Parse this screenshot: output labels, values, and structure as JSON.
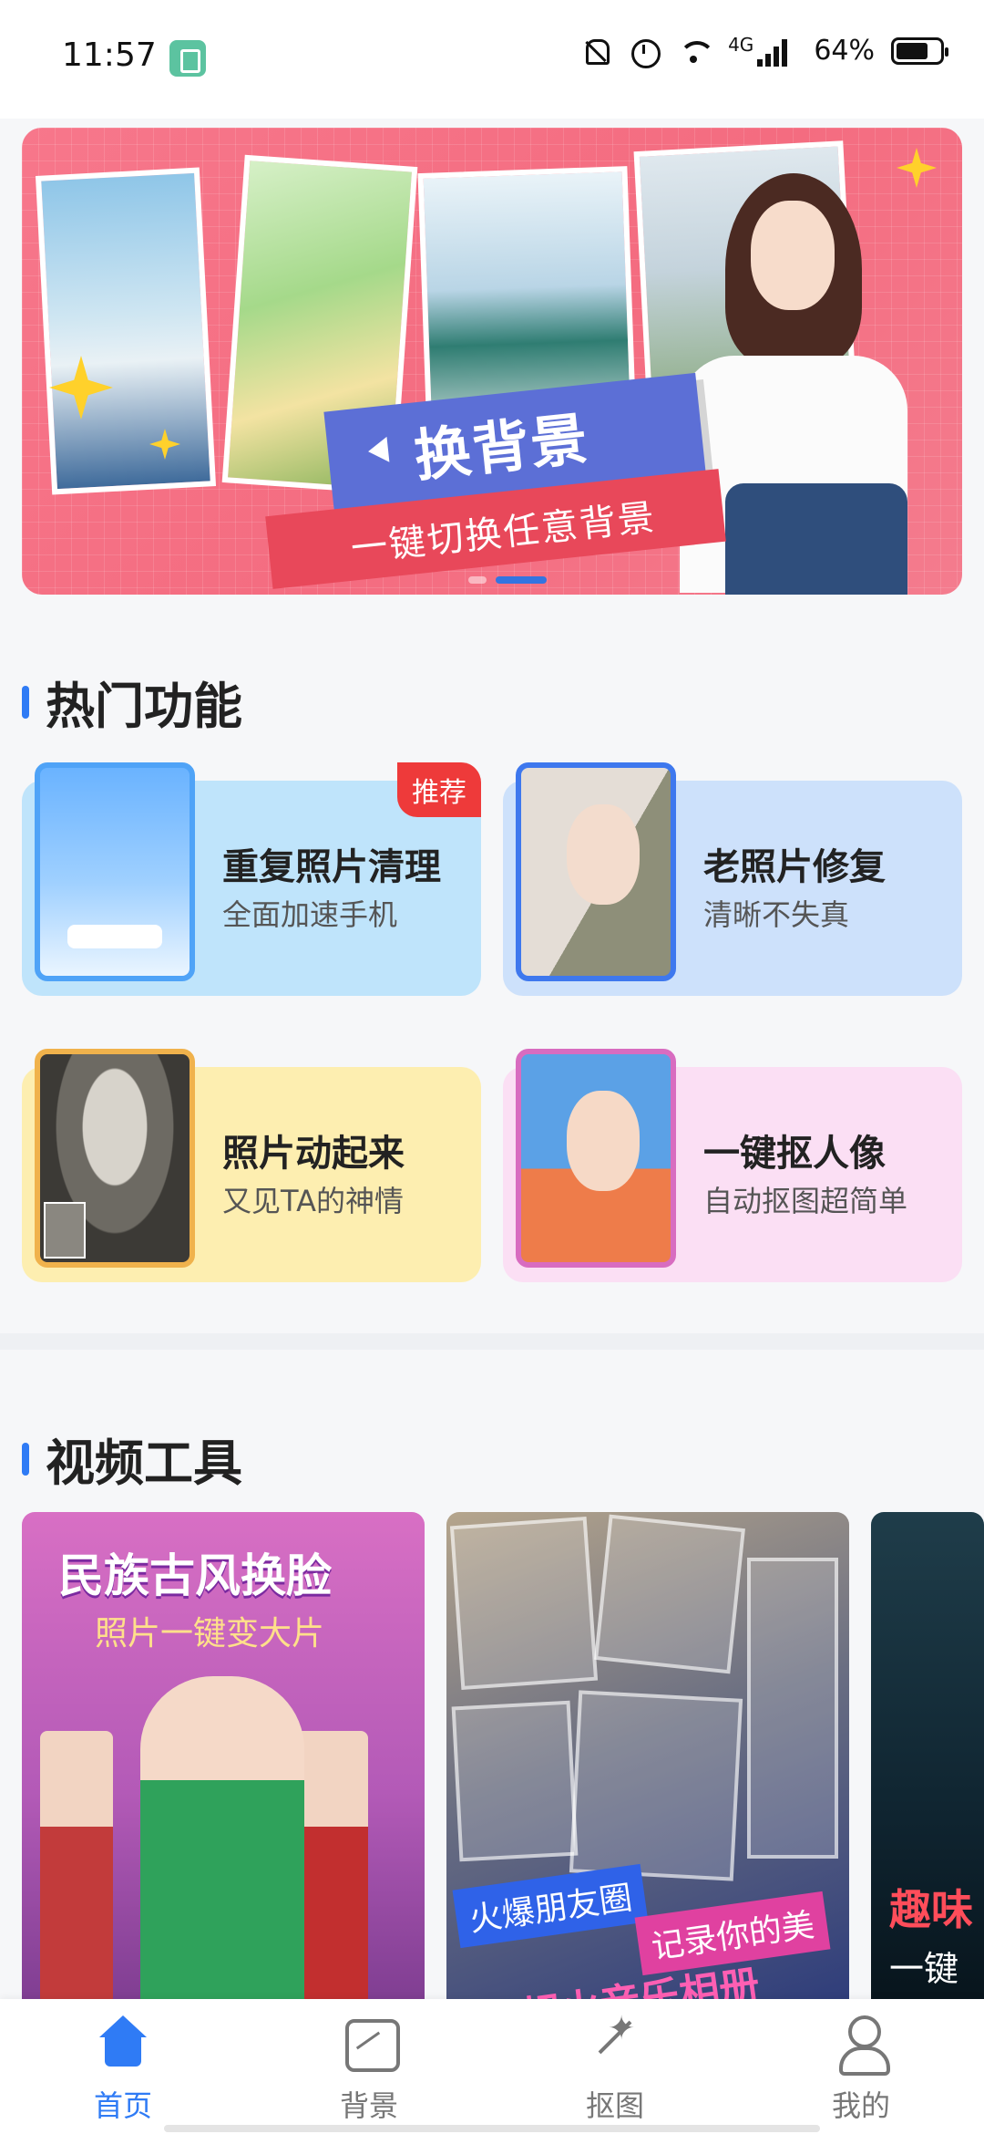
{
  "status_bar": {
    "time": "11:57",
    "network": "4G",
    "battery": "64%"
  },
  "banner": {
    "title": "换背景",
    "subtitle": "一键切换任意背景",
    "page_count": 2,
    "active_page": 2
  },
  "hot_section": {
    "title": "热门功能",
    "cards": [
      {
        "title": "重复照片清理",
        "subtitle": "全面加速手机",
        "tag": "推荐"
      },
      {
        "title": "老照片修复",
        "subtitle": "清晰不失真"
      },
      {
        "title": "照片动起来",
        "subtitle": "又见TA的神情"
      },
      {
        "title": "一键抠人像",
        "subtitle": "自动抠图超简单"
      }
    ]
  },
  "video_section": {
    "title": "视频工具",
    "cards": [
      {
        "title": "民族古风换脸",
        "subtitle": "照片一键变大片"
      },
      {
        "tag1": "火爆朋友圈",
        "tag2": "记录你的美",
        "tag3": "超火音乐相册"
      },
      {
        "text1": "趣味",
        "text2": "一键"
      }
    ]
  },
  "bottom_nav": {
    "items": [
      {
        "label": "首页",
        "icon": "home-icon",
        "active": true
      },
      {
        "label": "背景",
        "icon": "background-icon"
      },
      {
        "label": "抠图",
        "icon": "magic-cutout-icon"
      },
      {
        "label": "我的",
        "icon": "profile-icon"
      }
    ]
  },
  "colors": {
    "accent": "#2f7bf5",
    "tag_red": "#ee3a3a",
    "banner_pink": "#f46c80"
  }
}
